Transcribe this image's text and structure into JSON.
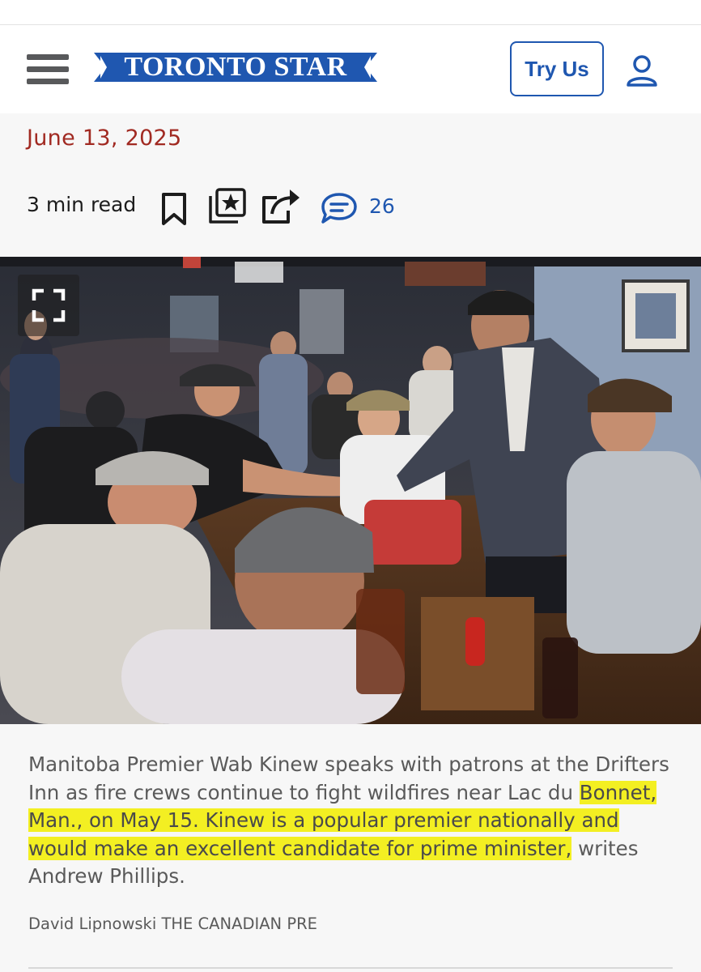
{
  "header": {
    "logo_text": "TORONTO STAR",
    "try_button_label": "Try Us",
    "brand_color": "#1f57b0",
    "menu_icon": "hamburger-menu-icon",
    "user_icon": "user-account-icon"
  },
  "article": {
    "date": "June 13, 2025",
    "read_time": "3 min read",
    "comment_count": "26",
    "action_icons": [
      "bookmark-icon",
      "gift-article-icon",
      "share-icon",
      "comments-icon"
    ]
  },
  "photo": {
    "expand_icon": "fullscreen-expand-icon",
    "caption_part1": "Manitoba Premier Wab Kinew speaks with patrons at the Drifters Inn as fire crews continue to fight wildfires near Lac du ",
    "caption_highlight": "Bonnet, Man., on May 15. Kinew is a popular premier nationally and would make an excellent candidate for prime minister,",
    "caption_part2": " writes Andrew Phillips.",
    "credit": "David Lipnowski THE CANADIAN PRE",
    "highlight_color": "#f3ef22"
  }
}
